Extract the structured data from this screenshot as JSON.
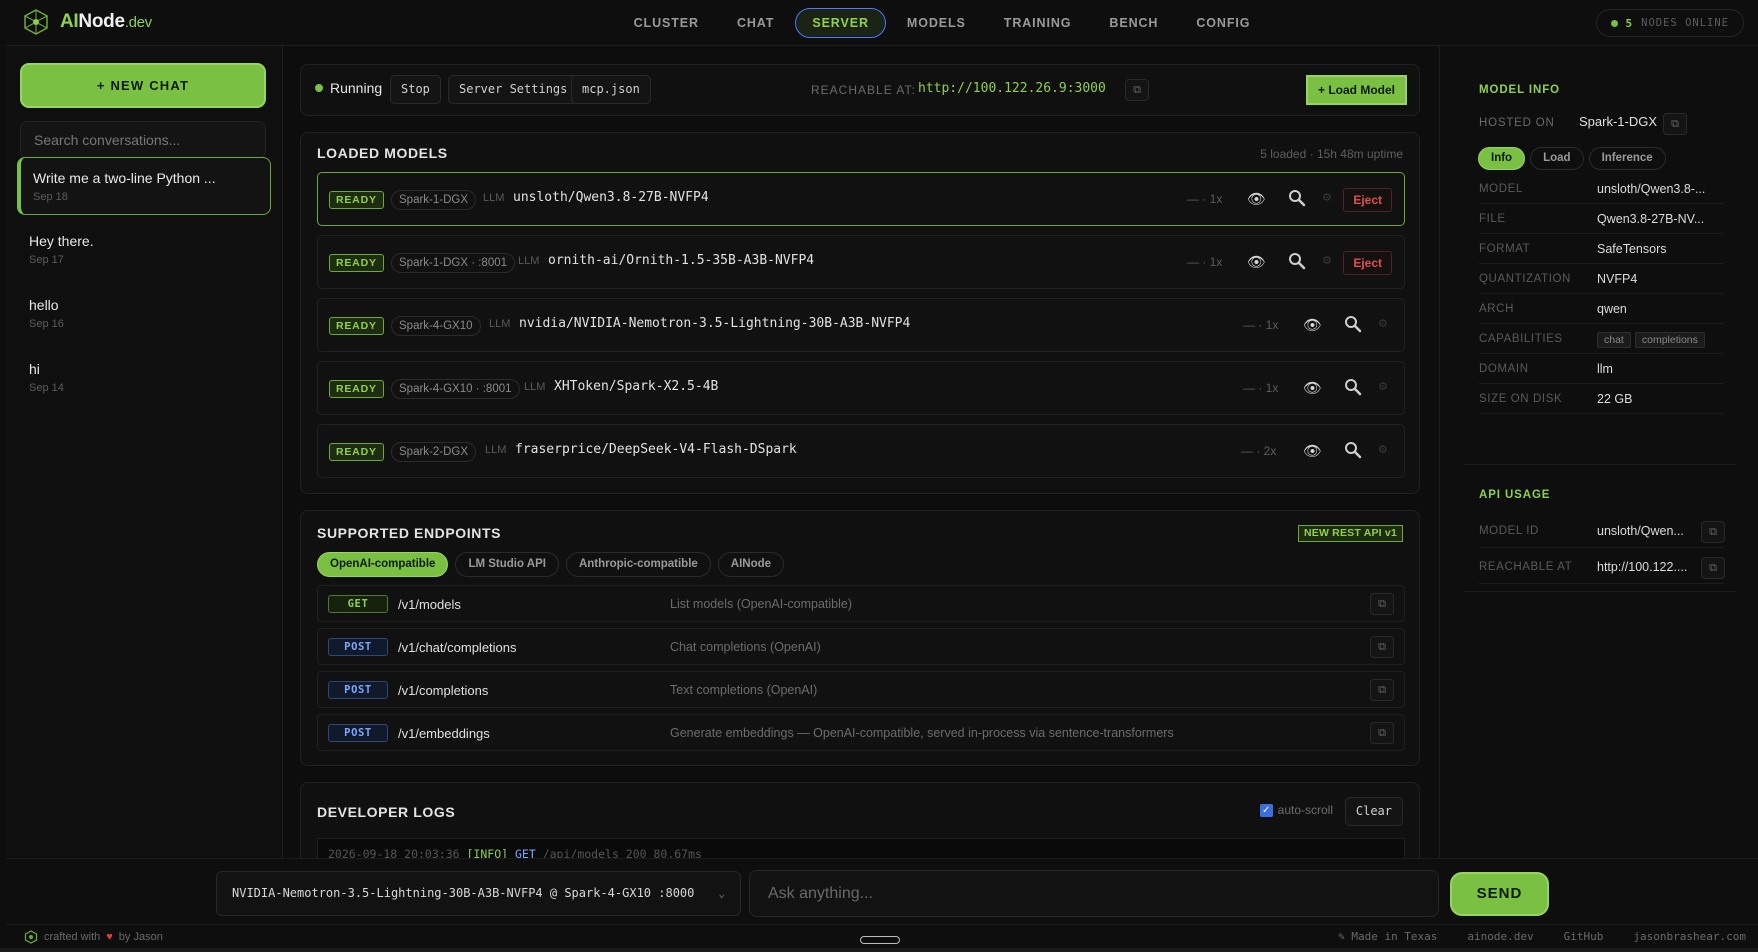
{
  "header": {
    "brand_ai": "AI",
    "brand_node": "Node",
    "brand_dev": ".dev",
    "tabs": [
      {
        "label": "CLUSTER",
        "active": false
      },
      {
        "label": "CHAT",
        "active": false
      },
      {
        "label": "SERVER",
        "active": true
      },
      {
        "label": "MODELS",
        "active": false
      },
      {
        "label": "TRAINING",
        "active": false
      },
      {
        "label": "BENCH",
        "active": false
      },
      {
        "label": "CONFIG",
        "active": false
      }
    ],
    "nodes_count": "5",
    "nodes_label": "NODES ONLINE"
  },
  "sidebar": {
    "new_chat_label": "+ NEW CHAT",
    "search_placeholder": "Search conversations...",
    "conversations": [
      {
        "title": "Write me a two-line Python ...",
        "date": "Sep 18",
        "active": true
      },
      {
        "title": "Hey there.",
        "date": "Sep 17",
        "active": false
      },
      {
        "title": "hello",
        "date": "Sep 16",
        "active": false
      },
      {
        "title": "hi",
        "date": "Sep 14",
        "active": false
      }
    ]
  },
  "server": {
    "status": "Running",
    "stop_label": "Stop",
    "settings_label": "Server Settings",
    "mcp_label": "mcp.json",
    "reachable_label": "REACHABLE AT:",
    "reachable_url": "http://100.122.26.9:3000",
    "load_model_label": "+ Load Model"
  },
  "models": {
    "title": "LOADED MODELS",
    "meta": "5 loaded · 15h 48m uptime",
    "rows": [
      {
        "status": "READY",
        "node": "Spark-1-DGX",
        "type": "LLM",
        "name": "unsloth/Qwen3.8-27B-NVFP4",
        "count": "— · 1x",
        "eject": "Eject"
      },
      {
        "status": "READY",
        "node": "Spark-1-DGX · :8001",
        "type": "LLM",
        "name": "ornith-ai/Ornith-1.5-35B-A3B-NVFP4",
        "count": "— · 1x",
        "eject": "Eject"
      },
      {
        "status": "READY",
        "node": "Spark-4-GX10",
        "type": "LLM",
        "name": "nvidia/NVIDIA-Nemotron-3.5-Lightning-30B-A3B-NVFP4",
        "count": "— · 1x",
        "eject": ""
      },
      {
        "status": "READY",
        "node": "Spark-4-GX10 · :8001",
        "type": "LLM",
        "name": "XHToken/Spark-X2.5-4B",
        "count": "— · 1x",
        "eject": ""
      },
      {
        "status": "READY",
        "node": "Spark-2-DGX",
        "type": "LLM",
        "name": "fraserprice/DeepSeek-V4-Flash-DSpark",
        "count": "— · 2x",
        "eject": ""
      }
    ]
  },
  "endpoints": {
    "title": "SUPPORTED ENDPOINTS",
    "badge": "NEW REST API v1",
    "tabs": [
      {
        "label": "OpenAI-compatible",
        "active": true
      },
      {
        "label": "LM Studio API",
        "active": false
      },
      {
        "label": "Anthropic-compatible",
        "active": false
      },
      {
        "label": "AINode",
        "active": false
      }
    ],
    "rows": [
      {
        "method": "GET",
        "path": "/v1/models",
        "desc": "List models (OpenAI-compatible)"
      },
      {
        "method": "POST",
        "path": "/v1/chat/completions",
        "desc": "Chat completions (OpenAI)"
      },
      {
        "method": "POST",
        "path": "/v1/completions",
        "desc": "Text completions (OpenAI)"
      },
      {
        "method": "POST",
        "path": "/v1/embeddings",
        "desc": "Generate embeddings — OpenAI-compatible, served in-process via sentence-transformers"
      }
    ]
  },
  "logs": {
    "title": "DEVELOPER LOGS",
    "autoscroll_label": "auto-scroll",
    "clear_label": "Clear",
    "line_time": "2026-09-18 20:03:36",
    "line_level": "[INFO]",
    "line_method": "GET",
    "line_rest": "/api/models 200 80.67ms"
  },
  "model_info": {
    "title": "MODEL INFO",
    "hosted_label": "HOSTED ON",
    "hosted_value": "Spark-1-DGX",
    "tabs": [
      {
        "label": "Info",
        "active": true
      },
      {
        "label": "Load",
        "active": false
      },
      {
        "label": "Inference",
        "active": false
      }
    ],
    "fields": [
      {
        "k": "MODEL",
        "v": "unsloth/Qwen3.8-..."
      },
      {
        "k": "FILE",
        "v": "Qwen3.8-27B-NV..."
      },
      {
        "k": "FORMAT",
        "v": "SafeTensors"
      },
      {
        "k": "QUANTIZATION",
        "v": "NVFP4"
      },
      {
        "k": "ARCH",
        "v": "qwen"
      },
      {
        "k": "CAPABILITIES",
        "v": ""
      },
      {
        "k": "DOMAIN",
        "v": "llm"
      },
      {
        "k": "SIZE ON DISK",
        "v": "22 GB"
      }
    ],
    "capabilities": [
      "chat",
      "completions"
    ]
  },
  "api_usage": {
    "title": "API USAGE",
    "model_id_label": "MODEL ID",
    "model_id_value": "unsloth/Qwen...",
    "reachable_label": "REACHABLE AT",
    "reachable_value": "http://100.122...."
  },
  "composer": {
    "model_select": "NVIDIA-Nemotron-3.5-Lightning-30B-A3B-NVFP4 @ Spark-4-GX10 :8000",
    "placeholder": "Ask anything...",
    "send_label": "SEND"
  },
  "footer": {
    "crafted": "crafted with",
    "by": "by Jason",
    "made_in": "Made in Texas",
    "links": [
      "ainode.dev",
      "GitHub",
      "jasonbrashear.com"
    ]
  },
  "colors": {
    "accent": "#7ac143",
    "accent_text": "#8fd14f",
    "danger": "#e05050",
    "post_blue": "#7da8ff"
  }
}
